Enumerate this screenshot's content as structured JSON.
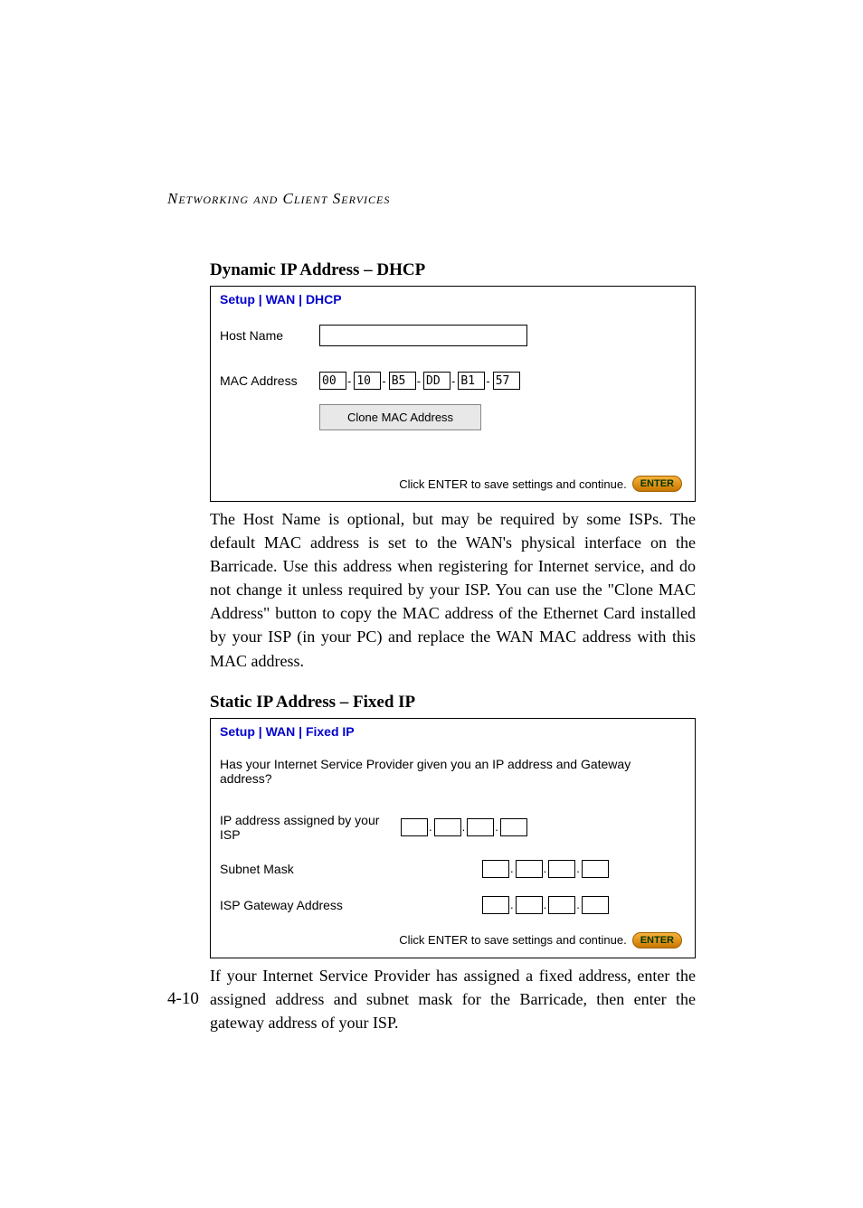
{
  "header": "Networking and Client Services",
  "section1": {
    "title": "Dynamic IP Address – DHCP",
    "breadcrumb": "Setup | WAN | DHCP",
    "host_label": "Host Name",
    "host_value": "",
    "mac_label": "MAC Address",
    "mac": [
      "00",
      "10",
      "B5",
      "DD",
      "B1",
      "57"
    ],
    "sep": "-",
    "clone_label": "Clone MAC Address",
    "hint": "Click ENTER to save settings and continue.",
    "enter_label": "ENTER",
    "body": "The Host Name is optional, but may be required by some ISPs. The default MAC address is set to the WAN's physical interface on the Barricade. Use this address when registering for Internet service, and do not change it unless required by your ISP. You can use the \"Clone MAC Address\" button to copy the MAC address of the Ethernet Card installed by your ISP (in your PC) and replace the WAN MAC address with this MAC address."
  },
  "section2": {
    "title": "Static IP Address – Fixed IP",
    "breadcrumb": "Setup | WAN | Fixed IP",
    "question": "Has your Internet Service Provider given you an IP address and Gateway address?",
    "ip_label": "IP address assigned by your ISP",
    "subnet_label": "Subnet Mask",
    "gateway_label": "ISP Gateway Address",
    "dot": ".",
    "hint": "Click ENTER to save settings and continue.",
    "enter_label": "ENTER",
    "body": "If your Internet Service Provider has assigned a fixed address, enter the assigned address and subnet mask for the Barricade, then enter the gateway address of your ISP."
  },
  "page_number": "4-10"
}
